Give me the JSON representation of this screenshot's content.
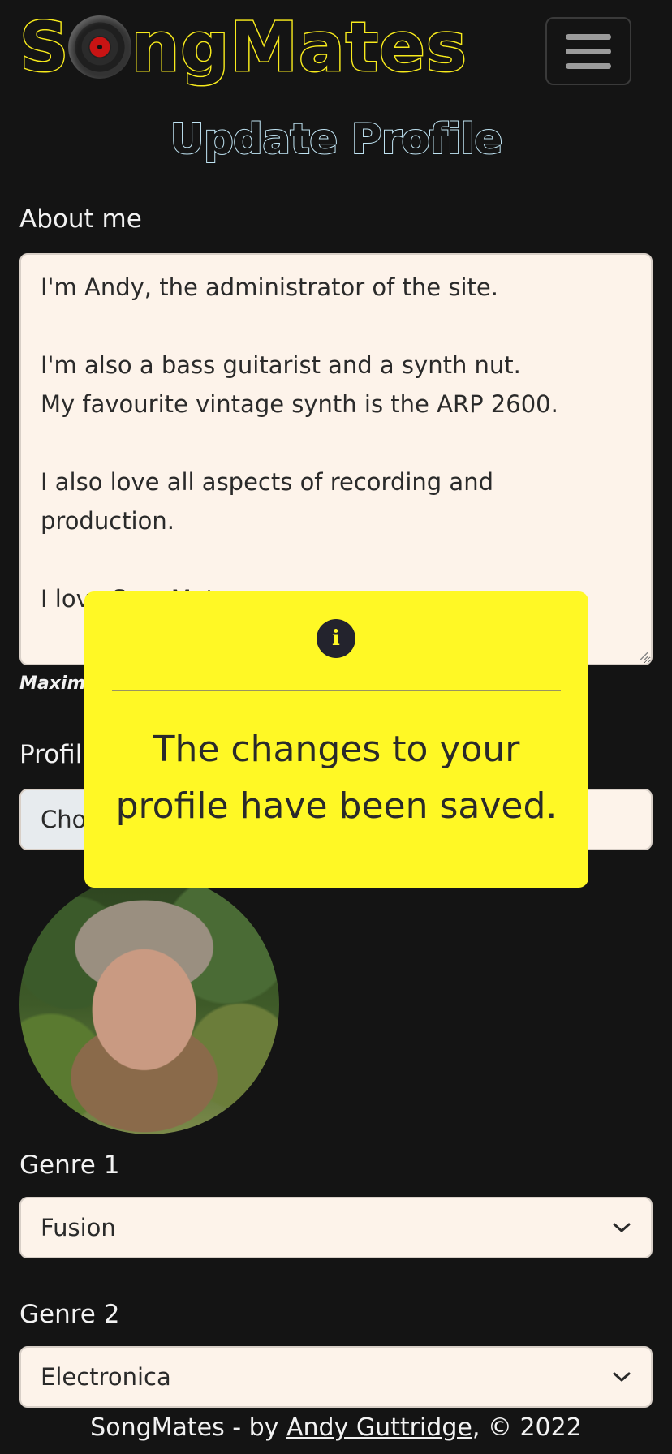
{
  "header": {
    "logo_text_first": "S",
    "logo_text_rest": "ngMates",
    "menu_icon": "hamburger-icon"
  },
  "page": {
    "title": "Update Profile"
  },
  "form": {
    "about_label": "About me",
    "about_value": "I'm Andy, the administrator of the site.\n\nI'm also a bass guitarist and a synth nut.\nMy favourite vintage synth is the ARP 2600.\n\nI also love all aspects of recording and production.\n\nI love SongMates",
    "about_helper": "Maximu",
    "picture_label": "Profile",
    "file_button_label": "Cho",
    "genre1_label": "Genre 1",
    "genre1_value": "Fusion",
    "genre2_label": "Genre 2",
    "genre2_value": "Electronica"
  },
  "toast": {
    "icon": "info-icon",
    "message": "The changes to your profile have been saved."
  },
  "footer": {
    "prefix": "SongMates - by ",
    "author_link": "Andy Guttridge",
    "suffix": ", © 2022"
  },
  "colors": {
    "background": "#141414",
    "logo_yellow": "#f7ea1c",
    "toast_yellow": "#fff825",
    "title_blue": "#bfe3f2",
    "input_bg": "#fdf3ea"
  }
}
